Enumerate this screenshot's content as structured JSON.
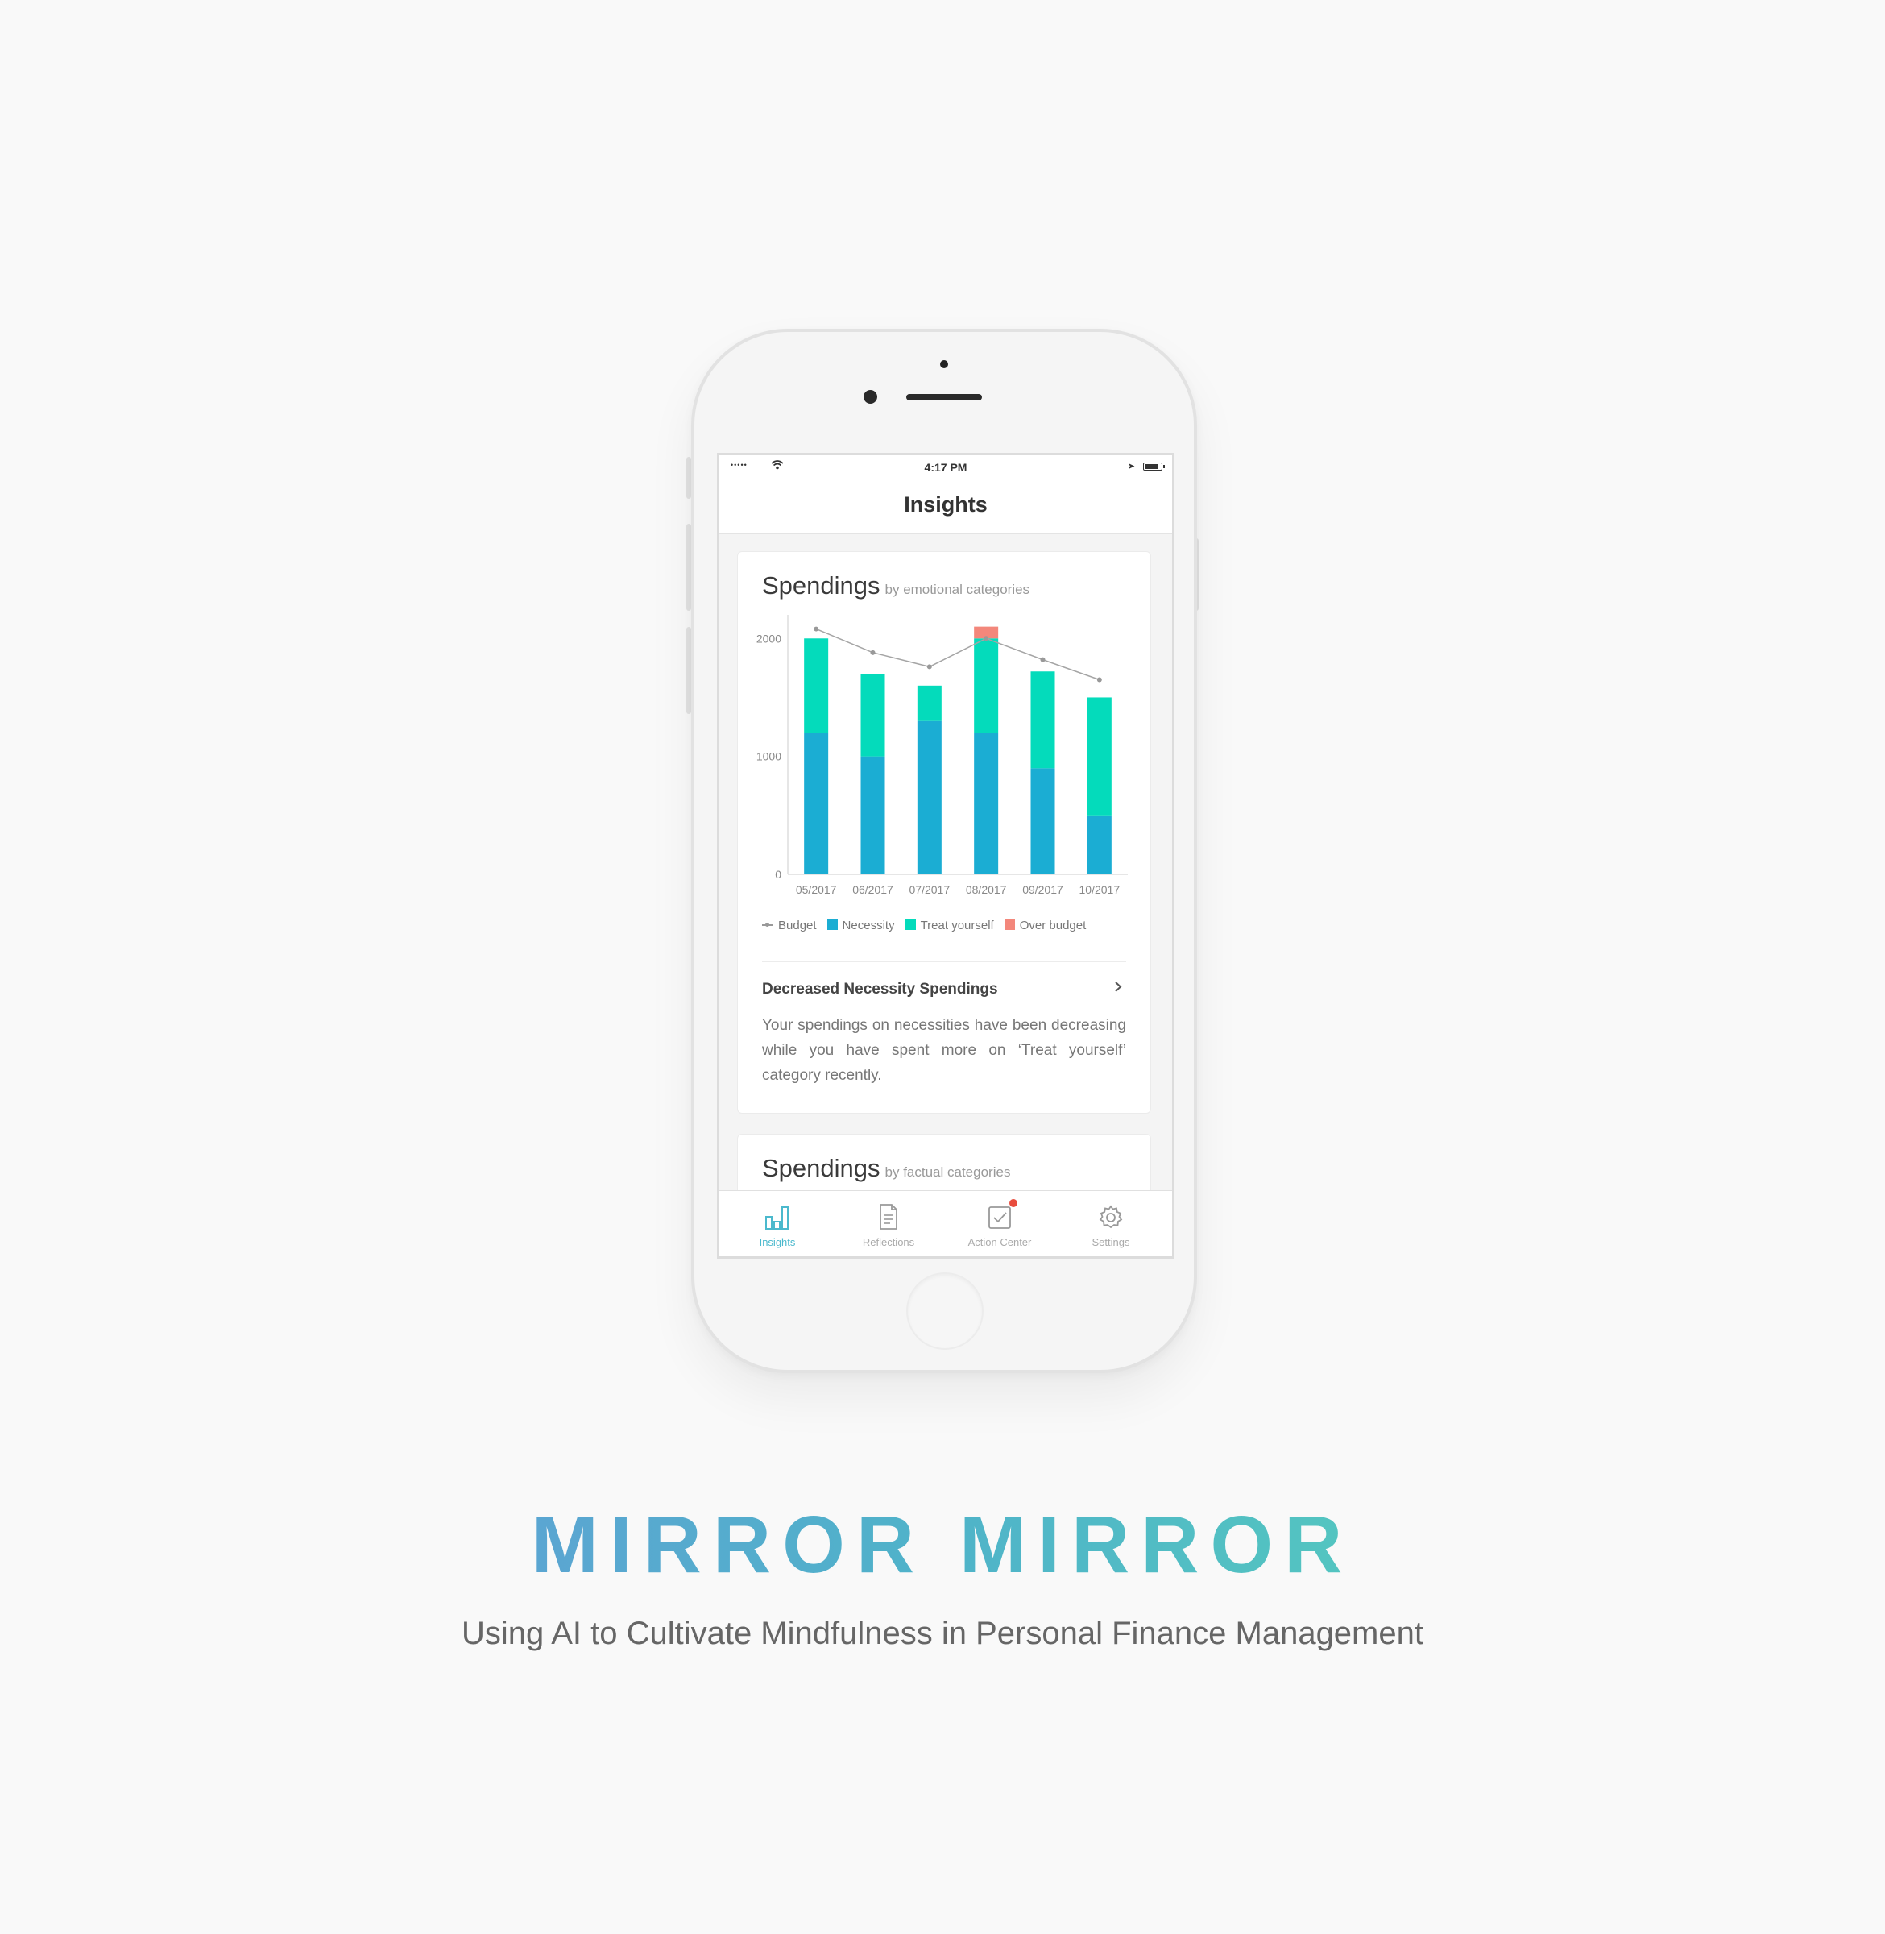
{
  "status_bar": {
    "signal": "•••••",
    "time": "4:17 PM"
  },
  "nav": {
    "title": "Insights"
  },
  "card1": {
    "title": "Spendings",
    "subtitle": "by emotional categories",
    "insight_title": "Decreased Necessity Spendings",
    "insight_body": "Your spendings on necessities have been decreasing while you have spent more on ‘Treat yourself’ category recently."
  },
  "card2": {
    "title": "Spendings",
    "subtitle": "by factual categories"
  },
  "legend": {
    "budget": "Budget",
    "necessity": "Necessity",
    "treat": "Treat yourself",
    "over": "Over budget"
  },
  "tabs": [
    {
      "label": "Insights",
      "icon": "bar-chart-icon",
      "active": true
    },
    {
      "label": "Reflections",
      "icon": "document-icon",
      "active": false
    },
    {
      "label": "Action Center",
      "icon": "checkbox-icon",
      "active": false,
      "badge": true
    },
    {
      "label": "Settings",
      "icon": "gear-icon",
      "active": false
    }
  ],
  "brand": {
    "title": "MIRROR MIRROR",
    "tagline": "Using AI to Cultivate Mindfulness in Personal Finance Management"
  },
  "colors": {
    "necessity": "#1badd3",
    "treat": "#04dbbb",
    "over": "#f3877b",
    "budget": "#a5a5a5",
    "accent": "#4bb9cd"
  },
  "chart_data": {
    "type": "bar",
    "stacked": true,
    "categories": [
      "05/2017",
      "06/2017",
      "07/2017",
      "08/2017",
      "09/2017",
      "10/2017"
    ],
    "series": [
      {
        "name": "Necessity",
        "values": [
          1200,
          1000,
          1300,
          1200,
          900,
          500
        ]
      },
      {
        "name": "Treat yourself",
        "values": [
          800,
          700,
          300,
          800,
          820,
          1000
        ]
      },
      {
        "name": "Over budget",
        "values": [
          0,
          0,
          0,
          100,
          0,
          0
        ]
      }
    ],
    "line_series": {
      "name": "Budget",
      "values": [
        2080,
        1880,
        1760,
        2000,
        1820,
        1650
      ]
    },
    "yticks": [
      0,
      1000,
      2000
    ],
    "ylim": [
      0,
      2200
    ],
    "legend_position": "bottom",
    "grid": false
  }
}
